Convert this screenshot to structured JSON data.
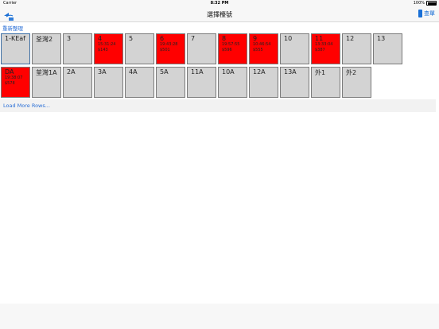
{
  "status": {
    "carrier": "Carrier",
    "time": "8:32 PM",
    "battery": "100%"
  },
  "nav": {
    "title": "選擇檯號",
    "menu_label": "查單"
  },
  "reorder_label": "重新整理",
  "row1": [
    {
      "name": "1-KEaf",
      "time": "",
      "num": "",
      "state": "selected"
    },
    {
      "name": "荃灣2",
      "time": "",
      "num": "",
      "state": "normal"
    },
    {
      "name": "3",
      "time": "",
      "num": "",
      "state": "normal"
    },
    {
      "name": "4",
      "time": "15:31:24",
      "num": "$143",
      "state": "red"
    },
    {
      "name": "5",
      "time": "",
      "num": "",
      "state": "normal"
    },
    {
      "name": "6",
      "time": "19:43:28",
      "num": "$501",
      "state": "red"
    },
    {
      "name": "7",
      "time": "",
      "num": "",
      "state": "normal"
    },
    {
      "name": "8",
      "time": "19:57:55",
      "num": "$596",
      "state": "red"
    },
    {
      "name": "9",
      "time": "10:46:54",
      "num": "$555",
      "state": "red"
    },
    {
      "name": "10",
      "time": "",
      "num": "",
      "state": "normal"
    },
    {
      "name": "11",
      "time": "13:33:04",
      "num": "$387",
      "state": "red"
    },
    {
      "name": "12",
      "time": "",
      "num": "",
      "state": "normal"
    },
    {
      "name": "13",
      "time": "",
      "num": "",
      "state": "normal"
    }
  ],
  "row2": [
    {
      "name": "DA",
      "time": "19:38:07",
      "num": "$578",
      "state": "red"
    },
    {
      "name": "荃灣1A",
      "time": "",
      "num": "",
      "state": "normal"
    },
    {
      "name": "2A",
      "time": "",
      "num": "",
      "state": "normal"
    },
    {
      "name": "3A",
      "time": "",
      "num": "",
      "state": "normal"
    },
    {
      "name": "4A",
      "time": "",
      "num": "",
      "state": "normal"
    },
    {
      "name": "5A",
      "time": "",
      "num": "",
      "state": "normal"
    },
    {
      "name": "11A",
      "time": "",
      "num": "",
      "state": "normal"
    },
    {
      "name": "10A",
      "time": "",
      "num": "",
      "state": "normal"
    },
    {
      "name": "12A",
      "time": "",
      "num": "",
      "state": "normal"
    },
    {
      "name": "13A",
      "time": "",
      "num": "",
      "state": "normal"
    },
    {
      "name": "外1",
      "time": "",
      "num": "",
      "state": "normal"
    },
    {
      "name": "外2",
      "time": "",
      "num": "",
      "state": "normal"
    }
  ],
  "load_more_label": "Load More Rows...",
  "colors": {
    "occupied": "#ff0000",
    "empty": "#d3d3d3",
    "accent": "#1a6fd6"
  },
  "icons": {
    "back": "back-arrows-icon",
    "menu": "document-icon"
  }
}
